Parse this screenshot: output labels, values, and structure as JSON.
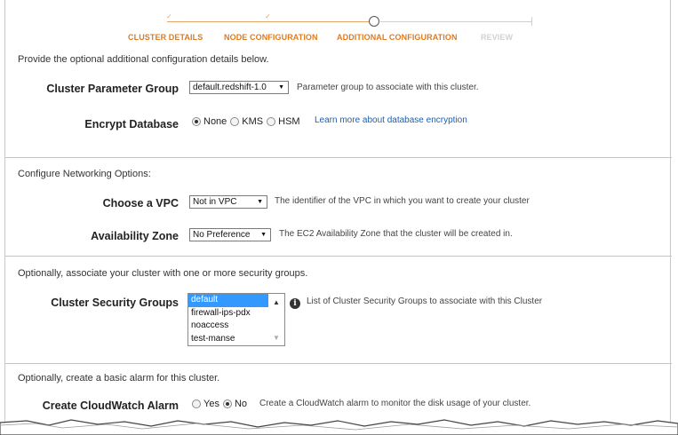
{
  "wizard": {
    "steps": [
      {
        "label": "CLUSTER DETAILS",
        "state": "done"
      },
      {
        "label": "NODE CONFIGURATION",
        "state": "done"
      },
      {
        "label": "ADDITIONAL CONFIGURATION",
        "state": "current"
      },
      {
        "label": "REVIEW",
        "state": "pending"
      }
    ],
    "check_glyph": "✓"
  },
  "intro": "Provide the optional additional configuration details below.",
  "parameter_group": {
    "label": "Cluster Parameter Group",
    "value": "default.redshift-1.0",
    "hint": "Parameter group to associate with this cluster."
  },
  "encryption": {
    "label": "Encrypt Database",
    "options": [
      "None",
      "KMS",
      "HSM"
    ],
    "selected": "None",
    "link": "Learn more about database encryption"
  },
  "networking": {
    "heading": "Configure Networking Options:",
    "vpc": {
      "label": "Choose a VPC",
      "value": "Not in VPC",
      "hint": "The identifier of the VPC in which you want to create your cluster"
    },
    "zone": {
      "label": "Availability Zone",
      "value": "No Preference",
      "hint": "The EC2 Availability Zone that the cluster will be created in."
    }
  },
  "security": {
    "heading": "Optionally, associate your cluster with one or more security groups.",
    "label": "Cluster Security Groups",
    "groups": [
      "default",
      "firewall-ips-pdx",
      "noaccess",
      "test-manse"
    ],
    "selected": "default",
    "hint": "List of Cluster Security Groups to associate with this Cluster",
    "info_icon": "info-icon"
  },
  "alarm": {
    "heading": "Optionally, create a basic alarm for this cluster.",
    "label": "Create CloudWatch Alarm",
    "options": [
      "Yes",
      "No"
    ],
    "selected": "No",
    "hint": "Create a CloudWatch alarm to monitor the disk usage of your cluster."
  },
  "colors": {
    "step_active": "#e07b1d",
    "step_pending": "#d2d2d2",
    "link": "#1a5fb4",
    "list_selection": "#3399ff"
  }
}
